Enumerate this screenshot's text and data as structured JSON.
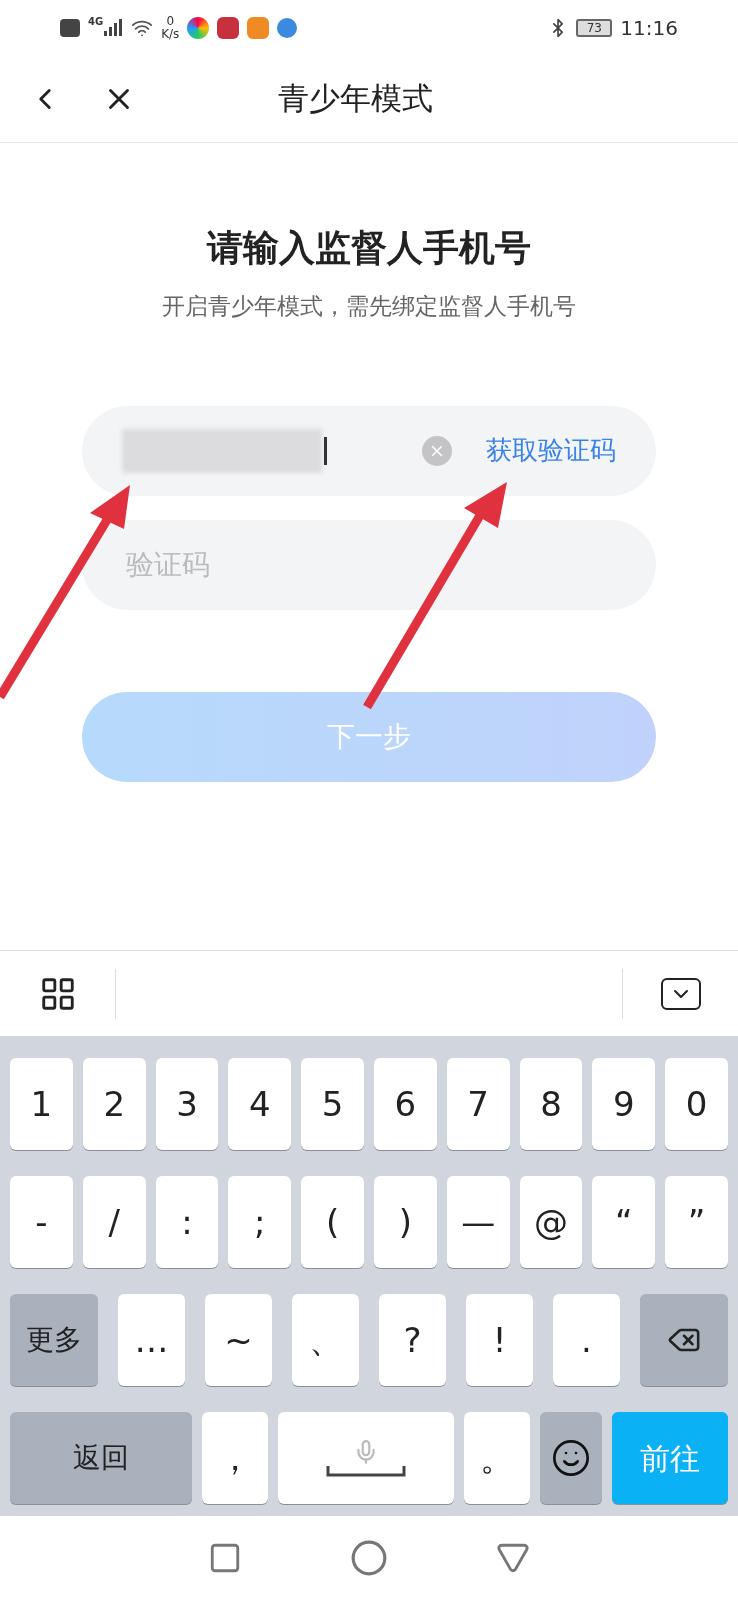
{
  "status_bar": {
    "network": "4G",
    "speed_value": "0",
    "speed_unit": "K/s",
    "battery": "73",
    "time": "11:16"
  },
  "nav": {
    "title": "青少年模式"
  },
  "heading": "请输入监督人手机号",
  "subtitle": "开启青少年模式，需先绑定监督人手机号",
  "phone_field": {
    "link": "获取验证码"
  },
  "code_field": {
    "placeholder": "验证码"
  },
  "next_button": {
    "label": "下一步",
    "disabled": true
  },
  "keyboard": {
    "rows": [
      {
        "keys": [
          {
            "kind": "char",
            "label": "1"
          },
          {
            "kind": "char",
            "label": "2"
          },
          {
            "kind": "char",
            "label": "3"
          },
          {
            "kind": "char",
            "label": "4"
          },
          {
            "kind": "char",
            "label": "5"
          },
          {
            "kind": "char",
            "label": "6"
          },
          {
            "kind": "char",
            "label": "7"
          },
          {
            "kind": "char",
            "label": "8"
          },
          {
            "kind": "char",
            "label": "9"
          },
          {
            "kind": "char",
            "label": "0"
          }
        ]
      },
      {
        "keys": [
          {
            "kind": "char",
            "label": "-"
          },
          {
            "kind": "char",
            "label": "/"
          },
          {
            "kind": "char",
            "label": ":"
          },
          {
            "kind": "char",
            "label": ";"
          },
          {
            "kind": "char",
            "label": "("
          },
          {
            "kind": "char",
            "label": ")"
          },
          {
            "kind": "char",
            "label": "—"
          },
          {
            "kind": "char",
            "label": "@"
          },
          {
            "kind": "char",
            "label": "“"
          },
          {
            "kind": "char",
            "label": "”"
          }
        ]
      },
      {
        "keys": [
          {
            "kind": "func",
            "label": "更多"
          },
          {
            "kind": "char",
            "label": "…"
          },
          {
            "kind": "char",
            "label": "~"
          },
          {
            "kind": "char",
            "label": "、"
          },
          {
            "kind": "char",
            "label": "?"
          },
          {
            "kind": "char",
            "label": "!"
          },
          {
            "kind": "char",
            "label": "."
          },
          {
            "kind": "backspace"
          }
        ]
      },
      {
        "keys": [
          {
            "kind": "wide",
            "label": "返回"
          },
          {
            "kind": "char",
            "label": "，"
          },
          {
            "kind": "space"
          },
          {
            "kind": "char",
            "label": "。"
          },
          {
            "kind": "emoji"
          },
          {
            "kind": "go",
            "label": "前往"
          }
        ]
      }
    ]
  }
}
